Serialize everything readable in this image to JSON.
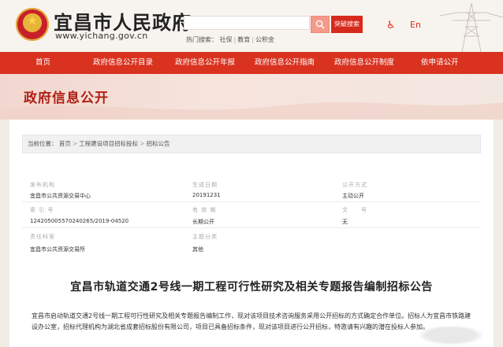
{
  "header": {
    "site_title": "宜昌市人民政府",
    "site_url": "www.yichang.gov.cn",
    "search_placeholder": "",
    "advanced_search_label": "突破搜索",
    "hot_search_label": "热门搜索：",
    "hot_links": [
      "社保",
      "教育",
      "公积金"
    ],
    "lang_label": "En"
  },
  "nav": {
    "items": [
      "首页",
      "政府信息公开目录",
      "政府信息公开年报",
      "政府信息公开指南",
      "政府信息公开制度",
      "依申请公开"
    ]
  },
  "banner": {
    "title": "政府信息公开"
  },
  "breadcrumb": {
    "prefix": "当前位置：",
    "items": [
      "首页",
      "工程建设项目招标投标",
      "招标公告"
    ]
  },
  "meta": {
    "publisher_label": "发布机构",
    "publisher_value": "宜昌市公共资源交易中心",
    "date_label": "生成日期",
    "date_value": "20191231",
    "mode_label": "公开方式",
    "mode_value": "主动公开",
    "index_label": "索 引 号",
    "index_value": "124205005570240265/2019-04520",
    "validity_label": "有 效 期",
    "validity_value": "长期公开",
    "doc_no_label": "文　　号",
    "doc_no_value": "无",
    "responsible_label": "责任科室",
    "responsible_value": "宜昌市公共资源交易所",
    "topic_label": "主题分类",
    "topic_value": "其他"
  },
  "document": {
    "title": "宜昌市轨道交通2号线一期工程可行性研究及相关专题报告编制招标公告",
    "body": "宜昌市启动轨道交通2号线一期工程可行性研究及相关专题报告编制工作，现对该项目技术咨询服务采用公开招标的方式确定合作单位。招标人为宜昌市铁路建设办公室，招标代理机构为湖北省成套招标股份有限公司，项目已具备招标条件，现对该项目进行公开招标，特邀请有兴趣的潜在投标人参加。"
  },
  "colors": {
    "brand_red": "#d9321f",
    "banner_text": "#b01f14"
  }
}
